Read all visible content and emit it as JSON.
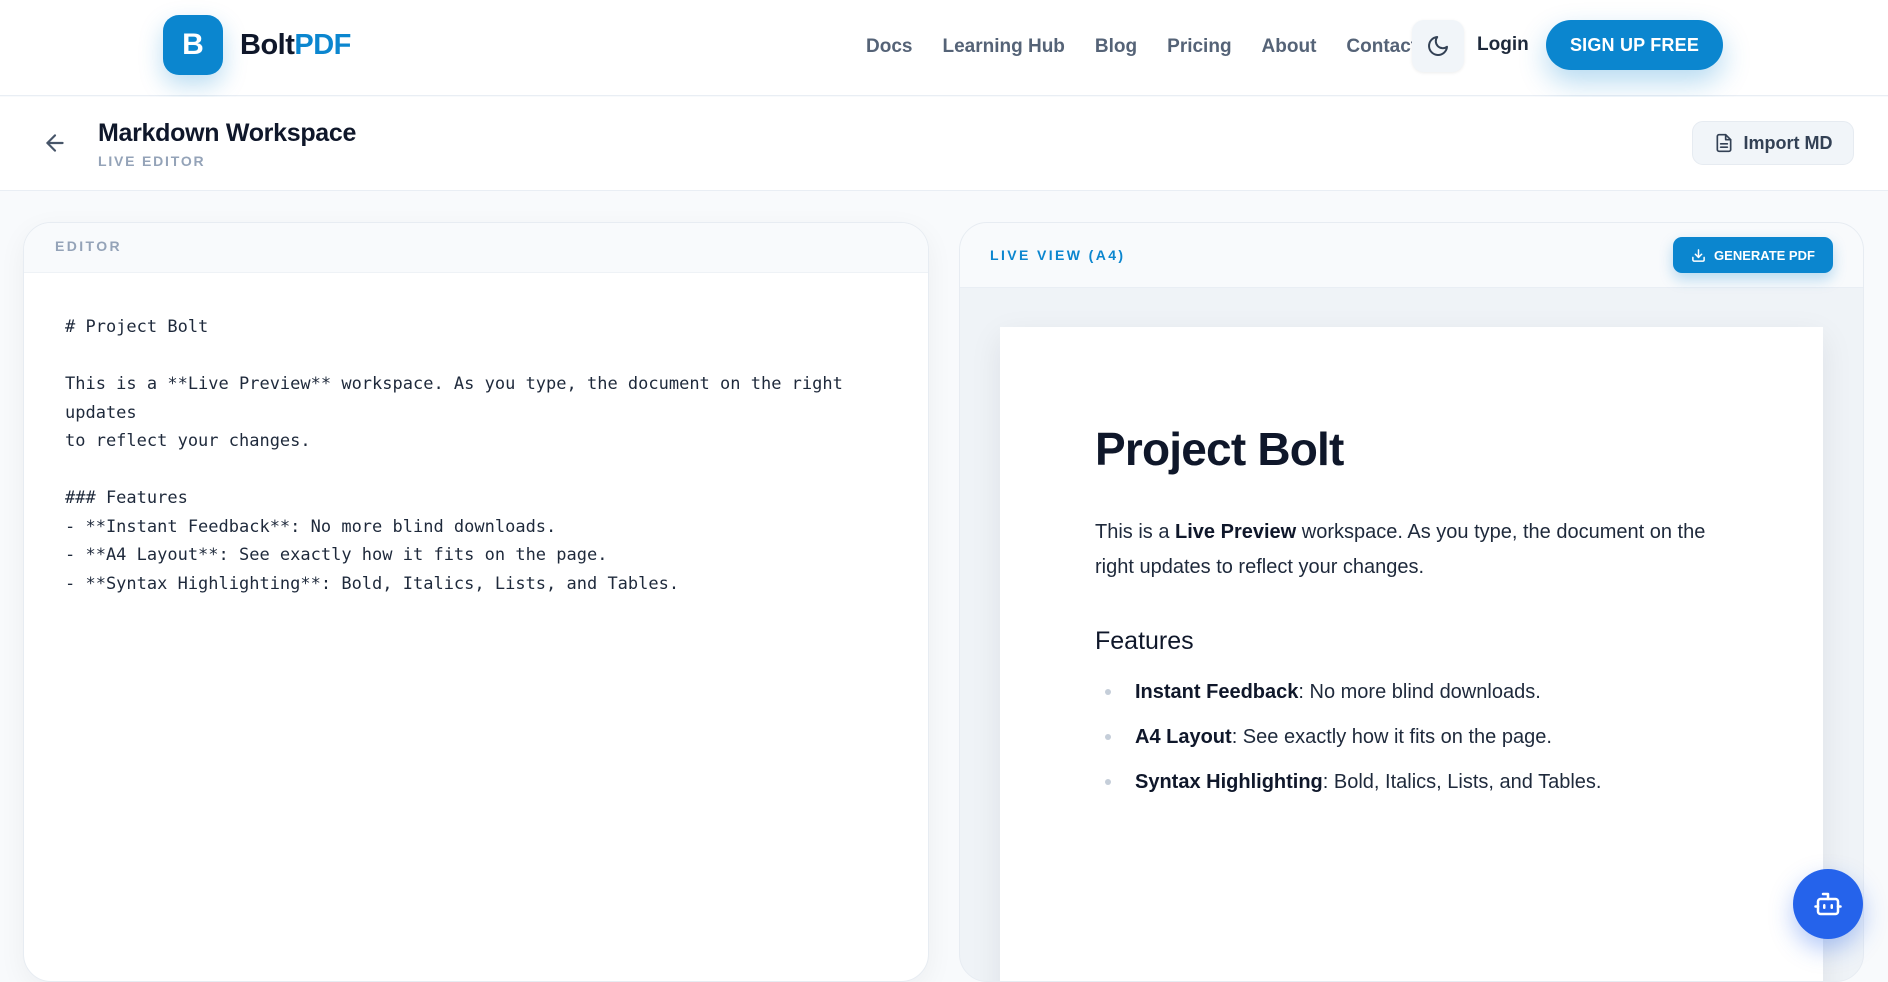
{
  "brand": {
    "badge": "B",
    "name_part1": "Bolt",
    "name_part2": "PDF",
    "accent_color": "#0b86cf"
  },
  "nav": {
    "links": [
      "Docs",
      "Learning Hub",
      "Blog",
      "Pricing",
      "About",
      "Contact"
    ],
    "theme_icon": "moon-icon",
    "login": "Login",
    "signup": "SIGN UP FREE"
  },
  "workspace": {
    "title": "Markdown Workspace",
    "subtitle": "LIVE EDITOR",
    "import_label": "Import MD"
  },
  "editor": {
    "label": "EDITOR",
    "content": "# Project Bolt\n\nThis is a **Live Preview** workspace. As you type, the document on the right updates\nto reflect your changes.\n\n### Features\n- **Instant Feedback**: No more blind downloads.\n- **A4 Layout**: See exactly how it fits on the page.\n- **Syntax Highlighting**: Bold, Italics, Lists, and Tables."
  },
  "preview": {
    "label": "LIVE VIEW (A4)",
    "generate_label": "GENERATE PDF",
    "doc": {
      "h1": "Project Bolt",
      "p_before": "This is a ",
      "p_bold": "Live Preview",
      "p_after": " workspace. As you type, the document on the right updates to reflect your changes.",
      "h3": "Features",
      "items": [
        {
          "bold": "Instant Feedback",
          "rest": ": No more blind downloads."
        },
        {
          "bold": "A4 Layout",
          "rest": ": See exactly how it fits on the page."
        },
        {
          "bold": "Syntax Highlighting",
          "rest": ": Bold, Italics, Lists, and Tables."
        }
      ]
    }
  },
  "assistant": {
    "icon": "robot-icon",
    "color": "#2563eb"
  }
}
